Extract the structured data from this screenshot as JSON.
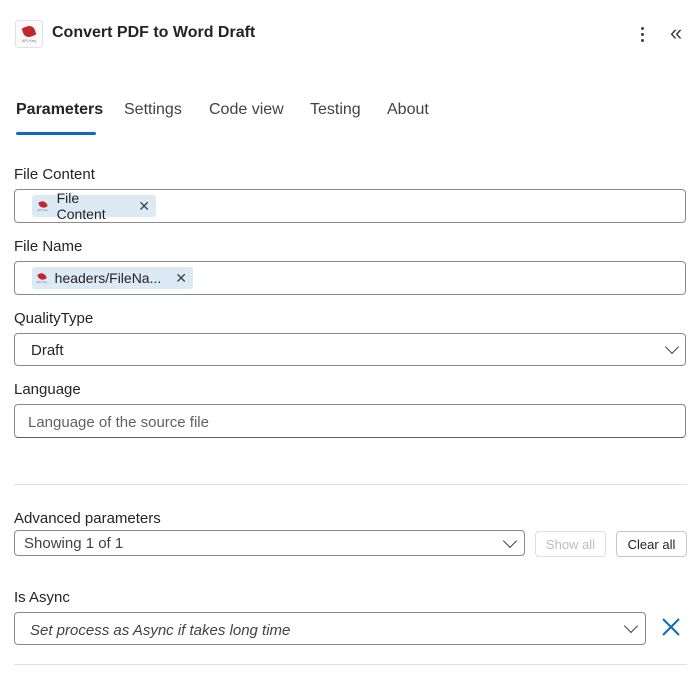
{
  "header": {
    "logo_text": "API Key",
    "title": "Convert PDF to Word Draft"
  },
  "tabs": [
    {
      "label": "Parameters",
      "active": true
    },
    {
      "label": "Settings"
    },
    {
      "label": "Code view"
    },
    {
      "label": "Testing"
    },
    {
      "label": "About"
    }
  ],
  "params": {
    "file_content": {
      "label": "File Content",
      "token": "File Content"
    },
    "file_name": {
      "label": "File Name",
      "token": "headers/FileNa..."
    },
    "quality_type": {
      "label": "QualityType",
      "value": "Draft"
    },
    "language": {
      "label": "Language",
      "placeholder": "Language of the source file"
    }
  },
  "advanced": {
    "label": "Advanced parameters",
    "showing": "Showing 1 of 1",
    "show_all": "Show all",
    "clear_all": "Clear all"
  },
  "is_async": {
    "label": "Is Async",
    "placeholder": "Set process as Async if takes long time"
  },
  "colors": {
    "accent": "#0f6cbd",
    "token_bg": "#dceaf6",
    "logo_red": "#c4262e"
  },
  "icons": [
    "app-logo-icon",
    "more-vertical-icon",
    "collapse-double-chevron-icon",
    "remove-token-icon",
    "chevron-down-icon",
    "close-icon"
  ]
}
